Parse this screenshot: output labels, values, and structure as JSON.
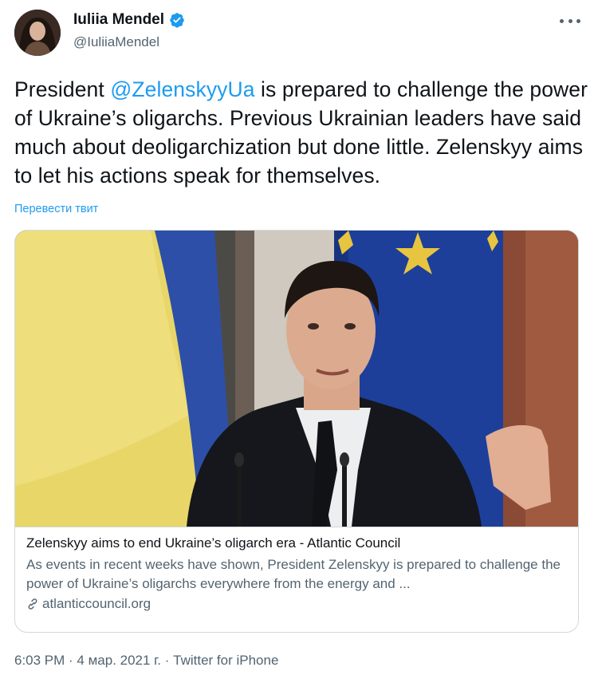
{
  "tweet": {
    "author": {
      "display_name": "Iuliia Mendel",
      "handle": "@IuliiaMendel",
      "verified": true
    },
    "text": {
      "prefix": "President ",
      "mention": "@ZelenskyyUa",
      "suffix": " is prepared to challenge the power of Ukraine’s oligarchs. Previous Ukrainian leaders have said much about deoligarchization but done little. Zelenskyy aims to let his actions speak for themselves."
    },
    "translate_label": "Перевести твит",
    "card": {
      "title": "Zelenskyy aims to end Ukraine’s oligarch era - Atlantic Council",
      "description": "As events in recent weeks have shown, President Zelenskyy is prepared to challenge the power of Ukraine’s oligarchs everywhere from the energy and ...",
      "domain": "atlanticcouncil.org"
    },
    "footer": "6:03 PM · 4 мар. 2021 г. · Twitter for iPhone"
  },
  "icons": {
    "verified": "verified-badge-icon",
    "more": "more-options-icon",
    "link": "link-icon"
  },
  "colors": {
    "accent": "#1d9bf0",
    "text_primary": "#0f1419",
    "text_secondary": "#536471",
    "border": "#cfd9de"
  }
}
